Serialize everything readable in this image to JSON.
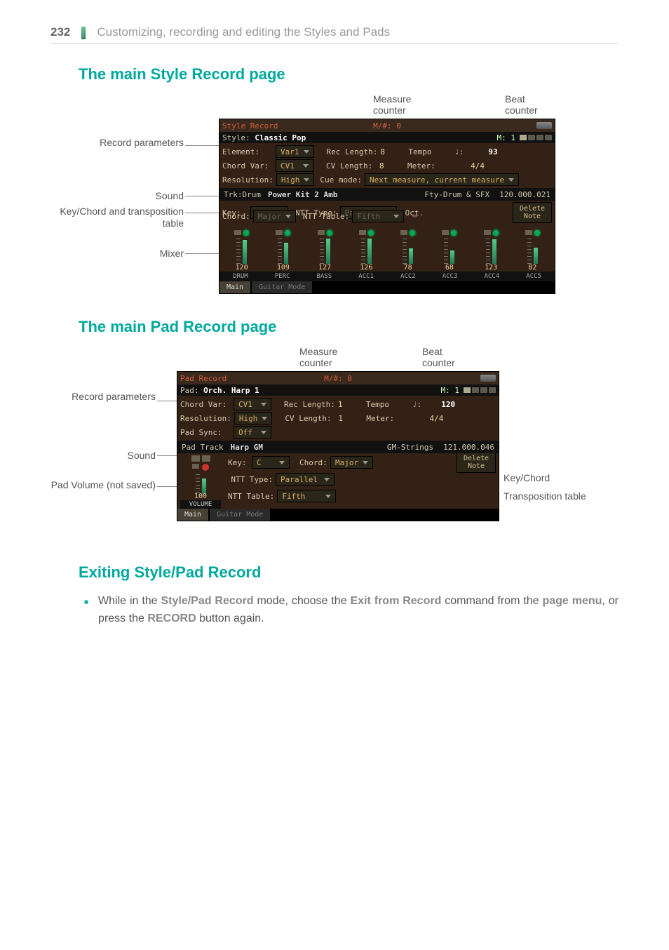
{
  "page": {
    "number": "232",
    "separator": "|",
    "title": "Customizing, recording and editing the Styles and Pads"
  },
  "sections": {
    "style_heading": "The main Style Record page",
    "pad_heading": "The main Pad Record page",
    "exit_heading": "Exiting Style/Pad Record"
  },
  "callouts": {
    "measure": "Measure counter",
    "beat": "Beat counter",
    "record_params": "Record parameters",
    "sound": "Sound",
    "keychord": "Key/Chord and transposition table",
    "mixer": "Mixer",
    "padvol": "Pad Volume (not saved)",
    "keychord_short": "Key/Chord",
    "trans_table": "Transposition table"
  },
  "style_screen": {
    "title": "Style Record",
    "measure": "M/#: 0",
    "style_label": "Style:",
    "style_name": "Classic Pop",
    "m_label": "M:",
    "m_val": "1",
    "element_label": "Element:",
    "element_val": "Var1",
    "reclen_label": "Rec Length:",
    "reclen_val": "8",
    "tempo_label": "Tempo",
    "tempo_unit": "♩:",
    "tempo_val": "93",
    "chordvar_label": "Chord Var:",
    "chordvar_val": "CV1",
    "cvlen_label": "CV Length:",
    "cvlen_val": "8",
    "meter_label": "Meter:",
    "meter_val": "4/4",
    "res_label": "Resolution:",
    "res_val": "High",
    "cue_label": "Cue mode:",
    "cue_val": "Next measure, current measure",
    "trk_label": "Trk:Drum",
    "trk_name": "Power Kit 2 Amb",
    "trk_bank": "Fty-Drum & SFX",
    "trk_num": "120.000.021",
    "key_label": "Key:",
    "key_val": "C",
    "ntttype_label": "NTT Type:",
    "ntttype_val": "Parallel",
    "oct_label": "Oct.",
    "chord_label": "Chord:",
    "chord_val": "Major",
    "ntttable_label": "NTT Table:",
    "ntttable_val": "Fifth",
    "kbd_icon": "⌨",
    "delete_note": "Delete Note",
    "mixer_vals": [
      "120",
      "109",
      "127",
      "126",
      "78",
      "68",
      "123",
      "82"
    ],
    "tracks": [
      "DRUM",
      "PERC",
      "BASS",
      "ACC1",
      "ACC2",
      "ACC3",
      "ACC4",
      "ACC5"
    ],
    "tab_main": "Main",
    "tab_guitar": "Guitar Mode"
  },
  "pad_screen": {
    "title": "Pad Record",
    "measure": "M/#: 0",
    "pad_label": "Pad:",
    "pad_name": "Orch. Harp 1",
    "m_label": "M:",
    "m_val": "1",
    "chordvar_label": "Chord Var:",
    "chordvar_val": "CV1",
    "reclen_label": "Rec Length:",
    "reclen_val": "1",
    "tempo_label": "Tempo",
    "tempo_unit": "♩:",
    "tempo_val": "120",
    "res_label": "Resolution:",
    "res_val": "High",
    "cvlen_label": "CV Length:",
    "cvlen_val": "1",
    "meter_label": "Meter:",
    "meter_val": "4/4",
    "padsync_label": "Pad Sync:",
    "padsync_val": "Off",
    "trk_label": "Pad Track",
    "trk_name": "Harp GM",
    "trk_bank": "GM-Strings",
    "trk_num": "121.000.046",
    "key_label": "Key:",
    "key_val": "C",
    "chord_label": "Chord:",
    "chord_val": "Major",
    "delete_note": "Delete Note",
    "ntttype_label": "NTT Type:",
    "ntttype_val": "Parallel",
    "ntttable_label": "NTT Table:",
    "ntttable_val": "Fifth",
    "vol_val": "100",
    "vol_label": "VOLUME",
    "tab_main": "Main",
    "tab_guitar": "Guitar Mode"
  },
  "exit_text": {
    "pre": "While in the ",
    "b1": "Style/Pad Record",
    "mid1": " mode, choose the ",
    "b2": "Exit from Record",
    "mid2": " command from the ",
    "b3": "page menu",
    "mid3": ", or press the ",
    "b4": "RECORD",
    "post": " button again."
  }
}
